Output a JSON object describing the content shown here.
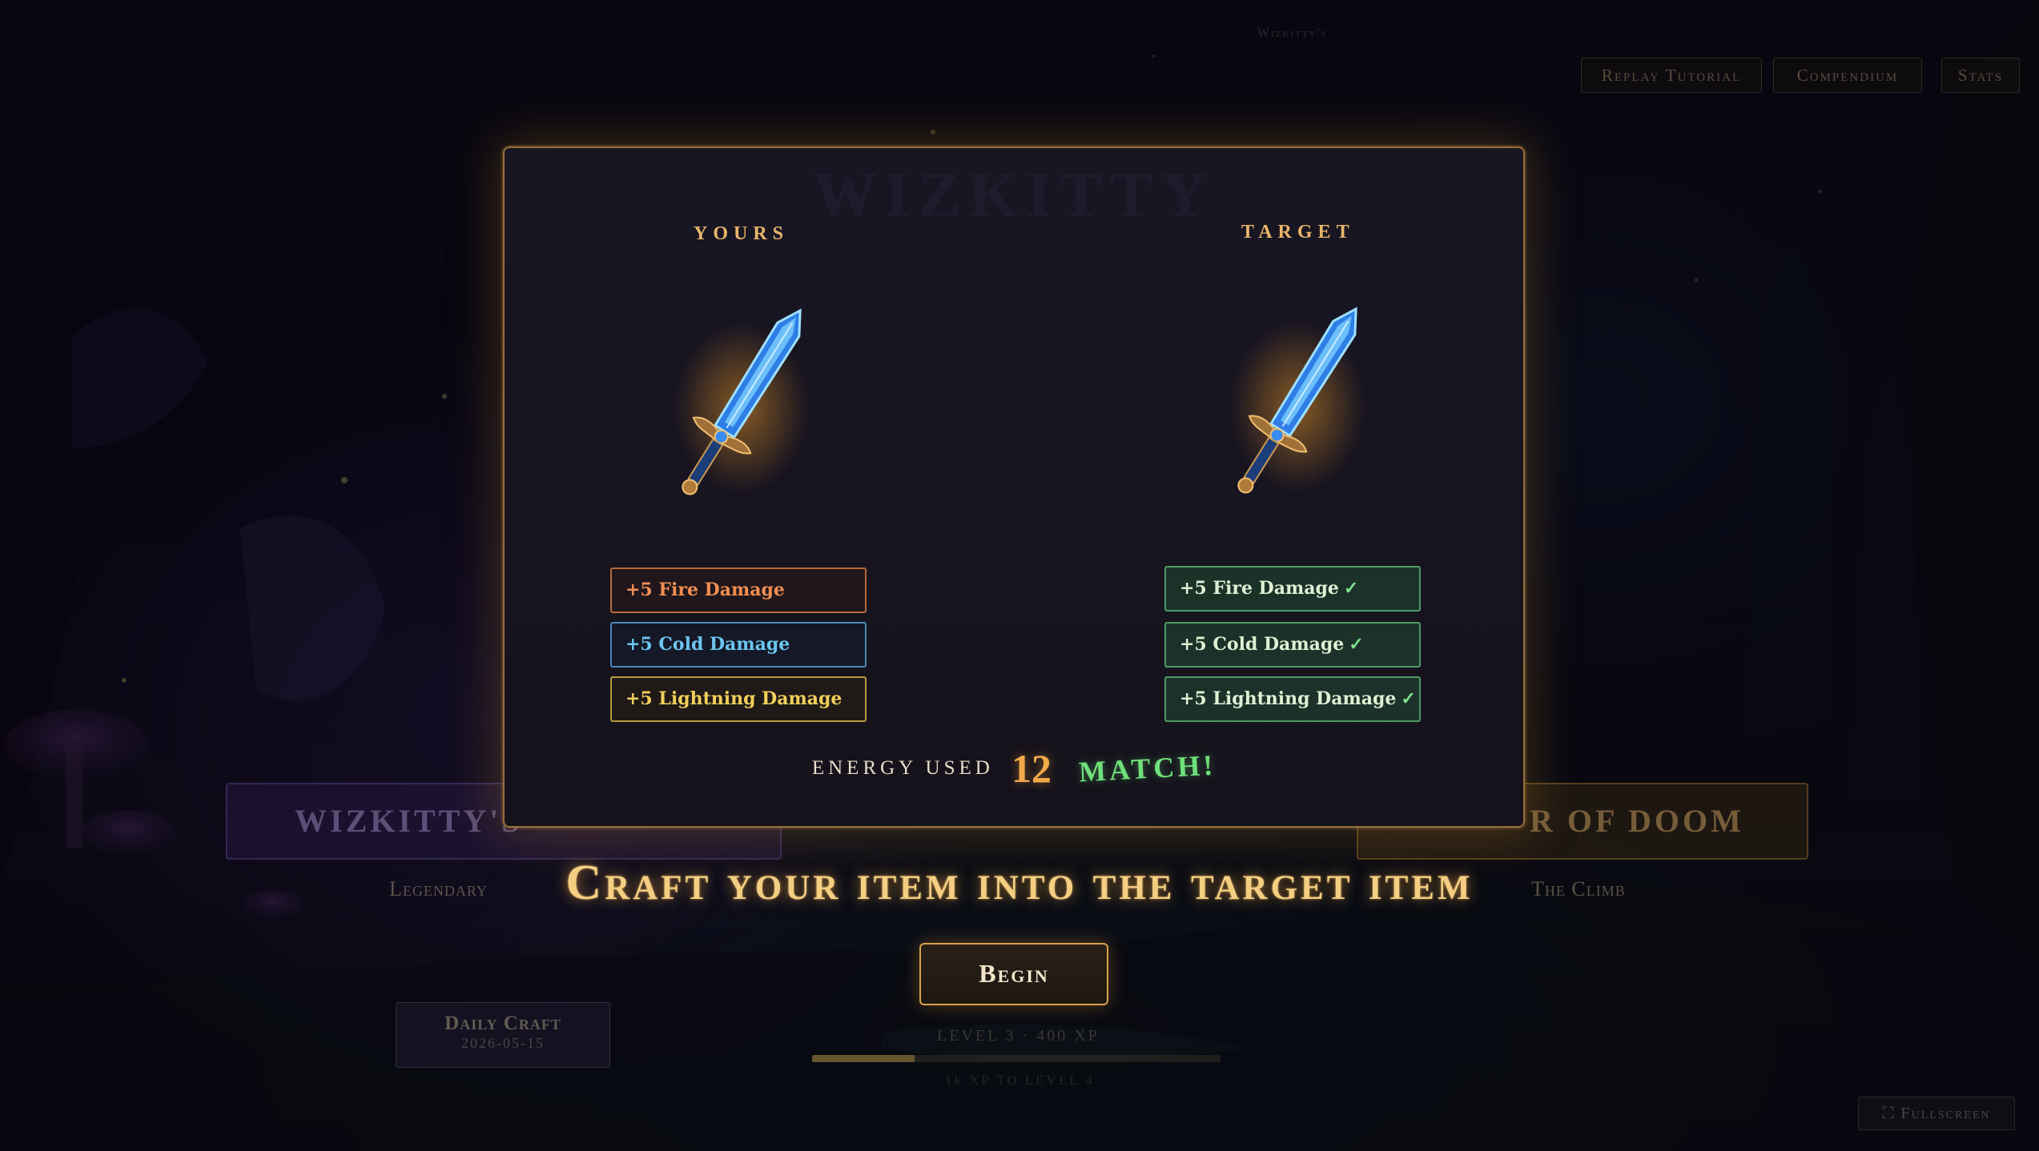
{
  "top_small_label": "Wizkitty's",
  "top_nav": {
    "replay_tutorial": "Replay Tutorial",
    "compendium": "Compendium",
    "stats": "Stats"
  },
  "modes": {
    "left_title": "WIZKITTY'S",
    "left_sub": "Legendary",
    "right_title": "R OF DOOM",
    "right_sub": "The Climb"
  },
  "daily": {
    "title": "Daily Craft",
    "date": "2026-05-15"
  },
  "progress": {
    "level_text": "LEVEL 3 · 400 XP",
    "xp_fraction": 0.25,
    "next_text": "1k XP TO LEVEL 4"
  },
  "fullscreen_label": "Fullscreen",
  "modal": {
    "ghost_title": "WIZKITTY",
    "yours": {
      "title": "YOURS",
      "item_icon": "blue-sword-icon",
      "stats": [
        {
          "label": "+5 Fire Damage",
          "element": "fire"
        },
        {
          "label": "+5 Cold Damage",
          "element": "cold"
        },
        {
          "label": "+5 Lightning Damage",
          "element": "lightning"
        }
      ]
    },
    "target": {
      "title": "TARGET",
      "item_icon": "blue-sword-icon",
      "stats": [
        {
          "label": "+5 Fire Damage",
          "matched": true
        },
        {
          "label": "+5 Cold Damage",
          "matched": true
        },
        {
          "label": "+5 Lightning Damage",
          "matched": true
        }
      ]
    },
    "check_glyph": "✓",
    "energy_label": "ENERGY USED",
    "energy_value": "12",
    "match_text": "MATCH!"
  },
  "headline": "Craft your item into the target item",
  "begin_label": "Begin",
  "colors": {
    "accent_gold": "#e8b56a",
    "fire": "#f28e52",
    "cold": "#6cc6f0",
    "lightning": "#f2cf5a",
    "match_green": "#6fe07a"
  }
}
